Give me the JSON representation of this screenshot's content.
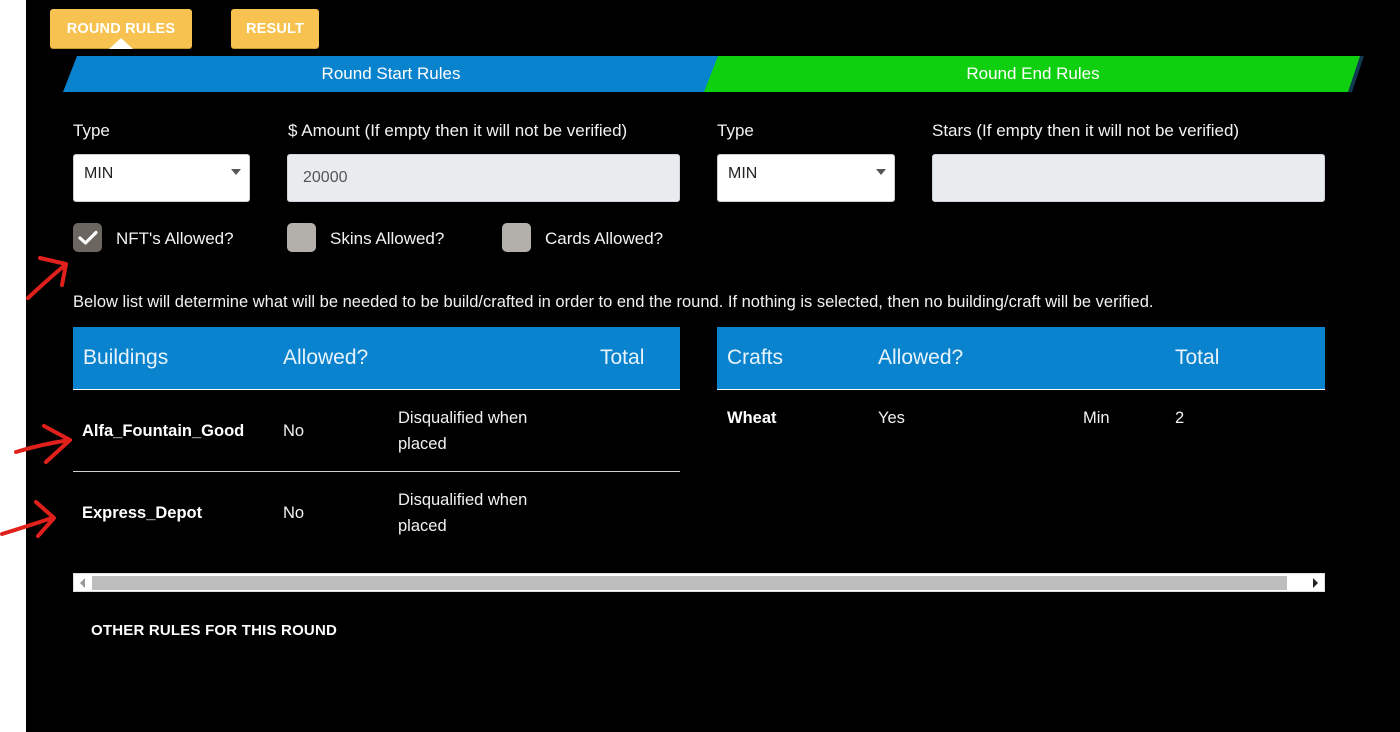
{
  "tabs": [
    {
      "label": "ROUND RULES",
      "active": true
    },
    {
      "label": "RESULT",
      "active": false
    }
  ],
  "banners": {
    "start": "Round Start Rules",
    "end": "Round End Rules"
  },
  "start_rules": {
    "type_label": "Type",
    "type_value": "MIN",
    "amount_label": "$ Amount (If empty then it will not be verified)",
    "amount_value": "20000"
  },
  "end_rules": {
    "type_label": "Type",
    "type_value": "MIN",
    "stars_label": "Stars (If empty then it will not be verified)",
    "stars_value": ""
  },
  "checkboxes": [
    {
      "label": "NFT's Allowed?",
      "checked": true
    },
    {
      "label": "Skins Allowed?",
      "checked": false
    },
    {
      "label": "Cards Allowed?",
      "checked": false
    }
  ],
  "note": "Below list will determine what will be needed to be build/crafted in order to end the round. If nothing is selected, then no building/craft will be verified.",
  "buildings": {
    "headers": [
      "Buildings",
      "Allowed?",
      "Total"
    ],
    "rows": [
      {
        "name": "Alfa_Fountain_Good",
        "allowed": "No",
        "total_line1": "Disqualified when",
        "total_line2": "placed"
      },
      {
        "name": "Express_Depot",
        "allowed": "No",
        "total_line1": "Disqualified when",
        "total_line2": "placed"
      }
    ]
  },
  "crafts": {
    "headers": [
      "Crafts",
      "Allowed?",
      "Total"
    ],
    "rows": [
      {
        "name": "Wheat",
        "allowed": "Yes",
        "mode": "Min",
        "total": "2"
      }
    ]
  },
  "other_rules_title": "OTHER RULES FOR THIS ROUND",
  "colors": {
    "tab": "#f7c24f",
    "start_banner": "#0a83cf",
    "end_banner": "#0fd00f",
    "table_header": "#0a83cf",
    "annotation": "#e0201b"
  },
  "icons": {
    "checkbox_checked": "checkmark-icon",
    "select_caret": "caret-down-icon",
    "annotation": "red-arrow-icon"
  }
}
